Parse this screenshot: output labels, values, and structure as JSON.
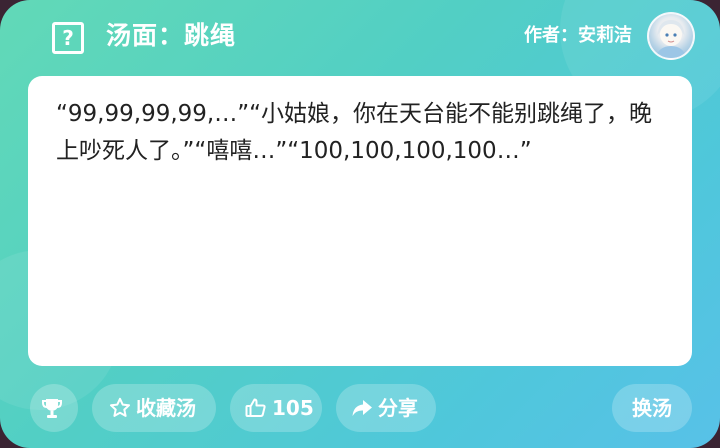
{
  "header": {
    "title": "汤面：跳绳",
    "author": "作者：安莉洁"
  },
  "content": {
    "text": "“99,99,99,99,…”“小姑娘，你在天台能不能别跳绳了，晚上吵死人了。”“嘻嘻…”“100,100,100,100…”"
  },
  "toolbar": {
    "favorite_label": "收藏汤",
    "like_count": "105",
    "share_label": "分享",
    "change_label": "换汤"
  },
  "icons": {
    "help": "question-square-icon",
    "trophy": "trophy-icon",
    "favorite": "star-outline-icon",
    "like": "thumbs-up-icon",
    "share": "share-arrow-icon"
  },
  "colors": {
    "gradient_start": "#62d9b7",
    "gradient_end": "#58c1e8",
    "text": "#222222",
    "panel": "#ffffff"
  }
}
